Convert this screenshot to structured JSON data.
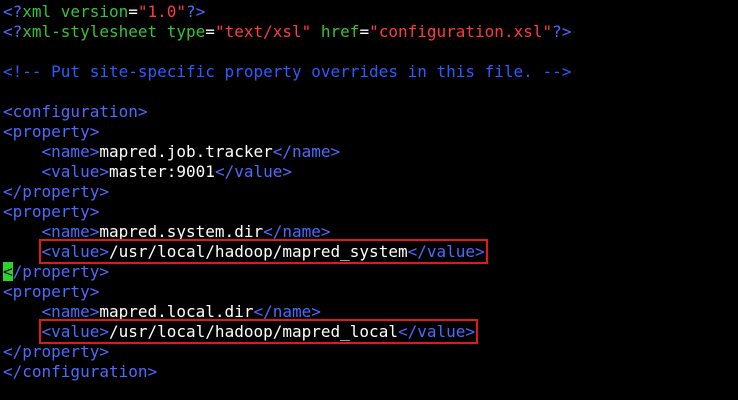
{
  "lines": [
    {
      "kind": "pi1",
      "open": "<?",
      "kw": "xml version",
      "eq": "=",
      "val": "\"1.0\"",
      "close": "?>"
    },
    {
      "kind": "pi2",
      "open": "<?",
      "kw": "xml-stylesheet ",
      "a1": "type",
      "eq1": "=",
      "v1": "\"text/xsl\"",
      "sp": " ",
      "a2": "href",
      "eq2": "=",
      "v2": "\"configuration.xsl\"",
      "close": "?>"
    },
    {
      "kind": "blank"
    },
    {
      "kind": "comment",
      "text": "<!-- Put site-specific property overrides in this file. -->"
    },
    {
      "kind": "blank"
    },
    {
      "kind": "tag",
      "indent": "",
      "text": "<configuration>"
    },
    {
      "kind": "tag",
      "indent": "",
      "text": "<property>"
    },
    {
      "kind": "elem",
      "indent": "    ",
      "open": "<name>",
      "value": "mapred.job.tracker",
      "close": "</name>"
    },
    {
      "kind": "elem",
      "indent": "    ",
      "open": "<value>",
      "value": "master:9001",
      "close": "</value>"
    },
    {
      "kind": "tag",
      "indent": "",
      "text": "</property>"
    },
    {
      "kind": "tag",
      "indent": "",
      "text": "<property>"
    },
    {
      "kind": "elem",
      "indent": "    ",
      "open": "<name>",
      "value": "mapred.system.dir",
      "close": "</name>"
    },
    {
      "kind": "elem",
      "indent": "    ",
      "open": "<value>",
      "value": "/usr/local/hadoop/mapred_system",
      "close": "</value>",
      "highlight": true
    },
    {
      "kind": "cursortag",
      "cursor": "<",
      "text": "/property>"
    },
    {
      "kind": "tag",
      "indent": "",
      "text": "<property>"
    },
    {
      "kind": "elem",
      "indent": "    ",
      "open": "<name>",
      "value": "mapred.local.dir",
      "close": "</name>"
    },
    {
      "kind": "elem",
      "indent": "    ",
      "open": "<value>",
      "value": "/usr/local/hadoop/mapred_local",
      "close": "</value>",
      "highlight": true
    },
    {
      "kind": "tag",
      "indent": "",
      "text": "</property>"
    },
    {
      "kind": "tag",
      "indent": "",
      "text": "</configuration>"
    }
  ],
  "colors": {
    "background": "#000000",
    "tag": "#4a6cff",
    "attribute": "#38c238",
    "string": "#ff3b3b",
    "comment": "#2b5cff",
    "text": "#ffffff",
    "highlight_box": "#e0191b",
    "cursor": "#2bd62b"
  }
}
